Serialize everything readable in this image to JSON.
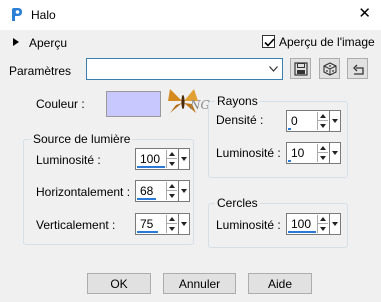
{
  "window": {
    "title": "Halo"
  },
  "preview": {
    "label": "Aperçu",
    "image_preview_label": "Aperçu de l'image",
    "image_preview_checked": true
  },
  "presets": {
    "label": "Paramètres",
    "value": ""
  },
  "color": {
    "label": "Couleur :",
    "value": "#c8c8ff"
  },
  "light_source": {
    "title": "Source de lumière",
    "luminosity": {
      "label": "Luminosité :",
      "value": "100",
      "level": 1.0
    },
    "horizontal": {
      "label": "Horizontalement :",
      "value": "68",
      "level": 0.68
    },
    "vertical": {
      "label": "Verticalement :",
      "value": "75",
      "level": 0.75
    }
  },
  "rays": {
    "title": "Rayons",
    "density": {
      "label": "Densité :",
      "value": "0",
      "level": 0.0
    },
    "luminosity": {
      "label": "Luminosité :",
      "value": "10",
      "level": 0.1
    }
  },
  "circles": {
    "title": "Cercles",
    "luminosity": {
      "label": "Luminosité :",
      "value": "100",
      "level": 1.0
    }
  },
  "buttons": {
    "ok": "OK",
    "cancel": "Annuler",
    "help": "Aide"
  }
}
